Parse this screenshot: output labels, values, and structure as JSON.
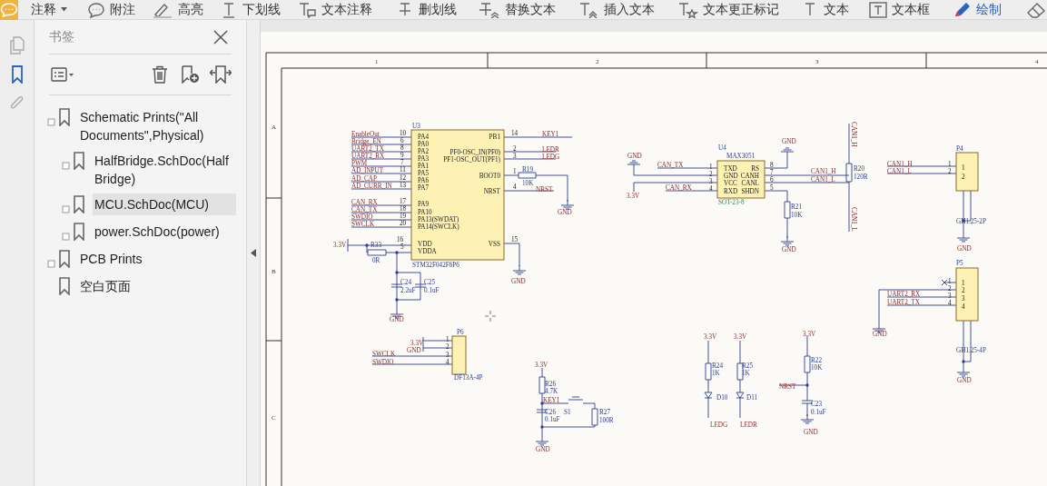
{
  "toolbar": [
    {
      "kind": "menu",
      "label": "注释",
      "selected": false
    },
    {
      "kind": "note",
      "label": "附注",
      "selected": false
    },
    {
      "kind": "highlight",
      "label": "高亮",
      "selected": false
    },
    {
      "kind": "underline",
      "label": "下划线",
      "selected": false
    },
    {
      "kind": "textnote",
      "label": "文本注释",
      "selected": false
    },
    {
      "kind": "strike",
      "label": "删划线",
      "selected": false
    },
    {
      "kind": "replace",
      "label": "替换文本",
      "selected": false
    },
    {
      "kind": "insert",
      "label": "插入文本",
      "selected": false
    },
    {
      "kind": "correct",
      "label": "文本更正标记",
      "selected": false
    },
    {
      "kind": "text",
      "label": "文本",
      "selected": false
    },
    {
      "kind": "textbox",
      "label": "文本框",
      "selected": false
    },
    {
      "kind": "draw",
      "label": "绘制",
      "selected": true
    },
    {
      "kind": "eraser",
      "selected": false
    }
  ],
  "panel_tabs": [
    {
      "kind": "pages",
      "selected": false
    },
    {
      "kind": "bookmarks",
      "selected": true
    },
    {
      "kind": "attachments",
      "selected": false
    }
  ],
  "bookmarks": {
    "title": "书签",
    "items": [
      {
        "label": "Schematic Prints(\"All Documents\",Physical)",
        "expandable": true,
        "selected": false,
        "children": [
          {
            "label": "HalfBridge.SchDoc(HalfBridge)",
            "expandable": true,
            "selected": false
          },
          {
            "label": "MCU.SchDoc(MCU)",
            "expandable": true,
            "selected": true
          },
          {
            "label": "power.SchDoc(power)",
            "expandable": true,
            "selected": false
          }
        ]
      },
      {
        "label": "PCB Prints",
        "expandable": true,
        "selected": false
      },
      {
        "label": "空白页面",
        "expandable": false,
        "selected": false
      }
    ]
  },
  "schematic": {
    "labels": [
      {
        "text": "1",
        "kind": "grid"
      },
      {
        "text": "2",
        "kind": "grid"
      },
      {
        "text": "3",
        "kind": "grid"
      },
      {
        "text": "4",
        "kind": "grid"
      },
      {
        "text": "A",
        "kind": "grid"
      },
      {
        "text": "B",
        "kind": "grid"
      },
      {
        "text": "C",
        "kind": "grid"
      },
      {
        "text": "U3",
        "kind": "part"
      },
      {
        "text": "EnableOut",
        "kind": "net"
      },
      {
        "text": "Bridge_EN",
        "kind": "net"
      },
      {
        "text": "UART2_TX",
        "kind": "net"
      },
      {
        "text": "UART2_RX",
        "kind": "net"
      },
      {
        "text": "PWM",
        "kind": "net"
      },
      {
        "text": "AD_INPUT",
        "kind": "net"
      },
      {
        "text": "AD_CAP",
        "kind": "net"
      },
      {
        "text": "AD_CURR_IN",
        "kind": "net"
      },
      {
        "text": "CAN_RX",
        "kind": "net"
      },
      {
        "text": "CAN_TX",
        "kind": "net"
      },
      {
        "text": "SWDIO",
        "kind": "net"
      },
      {
        "text": "SWCLK",
        "kind": "net"
      },
      {
        "text": "10",
        "kind": "pin"
      },
      {
        "text": "6",
        "kind": "pin"
      },
      {
        "text": "8",
        "kind": "pin"
      },
      {
        "text": "9",
        "kind": "pin"
      },
      {
        "text": "7",
        "kind": "pin"
      },
      {
        "text": "11",
        "kind": "pin"
      },
      {
        "text": "12",
        "kind": "pin"
      },
      {
        "text": "13",
        "kind": "pin"
      },
      {
        "text": "17",
        "kind": "pin"
      },
      {
        "text": "18",
        "kind": "pin"
      },
      {
        "text": "19",
        "kind": "pin"
      },
      {
        "text": "20",
        "kind": "pin"
      },
      {
        "text": "16",
        "kind": "pin"
      },
      {
        "text": "5",
        "kind": "pin"
      },
      {
        "text": "PA4",
        "kind": "pin"
      },
      {
        "text": "PA0",
        "kind": "pin"
      },
      {
        "text": "PA2",
        "kind": "pin"
      },
      {
        "text": "PA3",
        "kind": "pin"
      },
      {
        "text": "PA1",
        "kind": "pin"
      },
      {
        "text": "PA5",
        "kind": "pin"
      },
      {
        "text": "PA6",
        "kind": "pin"
      },
      {
        "text": "PA7",
        "kind": "pin"
      },
      {
        "text": "PA9",
        "kind": "pin"
      },
      {
        "text": "PA10",
        "kind": "pin"
      },
      {
        "text": "PA13(SWDAT)",
        "kind": "pin"
      },
      {
        "text": "PA14(SWCLK)",
        "kind": "pin"
      },
      {
        "text": "VDD",
        "kind": "pin"
      },
      {
        "text": "VDDA",
        "kind": "pin"
      },
      {
        "text": "PB1",
        "kind": "pin"
      },
      {
        "text": "PF0-OSC_IN(PF0)",
        "kind": "pin"
      },
      {
        "text": "PF1-OSC_OUT(PF1)",
        "kind": "pin"
      },
      {
        "text": "BOOT0",
        "kind": "pin"
      },
      {
        "text": "NRST",
        "kind": "pin"
      },
      {
        "text": "VSS",
        "kind": "pin"
      },
      {
        "text": "14",
        "kind": "pin"
      },
      {
        "text": "2",
        "kind": "pin"
      },
      {
        "text": "3",
        "kind": "pin"
      },
      {
        "text": "1",
        "kind": "pin"
      },
      {
        "text": "4",
        "kind": "pin"
      },
      {
        "text": "15",
        "kind": "pin"
      },
      {
        "text": "KEY1",
        "kind": "net"
      },
      {
        "text": "LEDR",
        "kind": "net"
      },
      {
        "text": "LEDG",
        "kind": "net"
      },
      {
        "text": "R19",
        "kind": "part"
      },
      {
        "text": "10K",
        "kind": "part"
      },
      {
        "text": "NRST",
        "kind": "net"
      },
      {
        "text": "GND",
        "kind": "net"
      },
      {
        "text": "STM32F042F6P6",
        "kind": "part"
      },
      {
        "text": "3.3V",
        "kind": "net"
      },
      {
        "text": "R33",
        "kind": "part"
      },
      {
        "text": "0R",
        "kind": "part"
      },
      {
        "text": "C24",
        "kind": "part"
      },
      {
        "text": "2.2uF",
        "kind": "part"
      },
      {
        "text": "C25",
        "kind": "part"
      },
      {
        "text": "0.1uF",
        "kind": "part"
      },
      {
        "text": "GND",
        "kind": "net"
      },
      {
        "text": "GND",
        "kind": "net"
      },
      {
        "text": "U4",
        "kind": "part"
      },
      {
        "text": "MAX3051",
        "kind": "part"
      },
      {
        "text": "TXD",
        "kind": "pin"
      },
      {
        "text": "RS",
        "kind": "pin"
      },
      {
        "text": "GND",
        "kind": "pin"
      },
      {
        "text": "CANH",
        "kind": "pin"
      },
      {
        "text": "VCC",
        "kind": "pin"
      },
      {
        "text": "CANL",
        "kind": "pin"
      },
      {
        "text": "RXD",
        "kind": "pin"
      },
      {
        "text": "SHDN",
        "kind": "pin"
      },
      {
        "text": "1",
        "kind": "pin"
      },
      {
        "text": "2",
        "kind": "pin"
      },
      {
        "text": "3",
        "kind": "pin"
      },
      {
        "text": "4",
        "kind": "pin"
      },
      {
        "text": "8",
        "kind": "pin"
      },
      {
        "text": "7",
        "kind": "pin"
      },
      {
        "text": "6",
        "kind": "pin"
      },
      {
        "text": "5",
        "kind": "pin"
      },
      {
        "text": "SOT-23-8",
        "kind": "package"
      },
      {
        "text": "CAN_TX",
        "kind": "net"
      },
      {
        "text": "CAN_RX",
        "kind": "net"
      },
      {
        "text": "GND",
        "kind": "net"
      },
      {
        "text": "3.3V",
        "kind": "net"
      },
      {
        "text": "GND",
        "kind": "net"
      },
      {
        "text": "CAN1_H",
        "kind": "net"
      },
      {
        "text": "CAN1_L",
        "kind": "net"
      },
      {
        "text": "R21",
        "kind": "part"
      },
      {
        "text": "10K",
        "kind": "part"
      },
      {
        "text": "GND",
        "kind": "net"
      },
      {
        "text": "CAN1_H",
        "kind": "vnet"
      },
      {
        "text": "R20",
        "kind": "part"
      },
      {
        "text": "120R",
        "kind": "part"
      },
      {
        "text": "CAN1_L",
        "kind": "vnet"
      },
      {
        "text": "P4",
        "kind": "part"
      },
      {
        "text": "CAN1_H",
        "kind": "net"
      },
      {
        "text": "CAN1_L",
        "kind": "net"
      },
      {
        "text": "1",
        "kind": "pin"
      },
      {
        "text": "2",
        "kind": "pin"
      },
      {
        "text": "1",
        "kind": "pin"
      },
      {
        "text": "2",
        "kind": "pin"
      },
      {
        "text": "GH1.25-2P",
        "kind": "part"
      },
      {
        "text": "GND",
        "kind": "net"
      },
      {
        "text": "P5",
        "kind": "part"
      },
      {
        "text": "1",
        "kind": "pin"
      },
      {
        "text": "2",
        "kind": "pin"
      },
      {
        "text": "3",
        "kind": "pin"
      },
      {
        "text": "4",
        "kind": "pin"
      },
      {
        "text": "1",
        "kind": "pin"
      },
      {
        "text": "2",
        "kind": "pin"
      },
      {
        "text": "3",
        "kind": "pin"
      },
      {
        "text": "4",
        "kind": "pin"
      },
      {
        "text": "UART2_RX",
        "kind": "net"
      },
      {
        "text": "UART2_TX",
        "kind": "net"
      },
      {
        "text": "GND",
        "kind": "net"
      },
      {
        "text": "GH1.25-4P",
        "kind": "part"
      },
      {
        "text": "GND",
        "kind": "net"
      },
      {
        "text": "P6",
        "kind": "part"
      },
      {
        "text": "3.3V",
        "kind": "net"
      },
      {
        "text": "GND",
        "kind": "net"
      },
      {
        "text": "SWCLK",
        "kind": "net"
      },
      {
        "text": "SWDIO",
        "kind": "net"
      },
      {
        "text": "1",
        "kind": "pin"
      },
      {
        "text": "2",
        "kind": "pin"
      },
      {
        "text": "3",
        "kind": "pin"
      },
      {
        "text": "4",
        "kind": "pin"
      },
      {
        "text": "DF13A-4P",
        "kind": "part"
      },
      {
        "text": "3.3V",
        "kind": "net"
      },
      {
        "text": "R26",
        "kind": "part"
      },
      {
        "text": "4.7K",
        "kind": "part"
      },
      {
        "text": "KEY1",
        "kind": "net"
      },
      {
        "text": "C26",
        "kind": "part"
      },
      {
        "text": "S1",
        "kind": "part"
      },
      {
        "text": "0.1uF",
        "kind": "part"
      },
      {
        "text": "R27",
        "kind": "part"
      },
      {
        "text": "100R",
        "kind": "part"
      },
      {
        "text": "GND",
        "kind": "net"
      },
      {
        "text": "3.3V",
        "kind": "net"
      },
      {
        "text": "3.3V",
        "kind": "net"
      },
      {
        "text": "R24",
        "kind": "part"
      },
      {
        "text": "1K",
        "kind": "part"
      },
      {
        "text": "R25",
        "kind": "part"
      },
      {
        "text": "1K",
        "kind": "part"
      },
      {
        "text": "D10",
        "kind": "part"
      },
      {
        "text": "D11",
        "kind": "part"
      },
      {
        "text": "LEDG",
        "kind": "net"
      },
      {
        "text": "LEDR",
        "kind": "net"
      },
      {
        "text": "3.3V",
        "kind": "net"
      },
      {
        "text": "R22",
        "kind": "part"
      },
      {
        "text": "10K",
        "kind": "part"
      },
      {
        "text": "NRST",
        "kind": "net"
      },
      {
        "text": "C23",
        "kind": "part"
      },
      {
        "text": "0.1uF",
        "kind": "part"
      },
      {
        "text": "GND",
        "kind": "net"
      }
    ]
  }
}
